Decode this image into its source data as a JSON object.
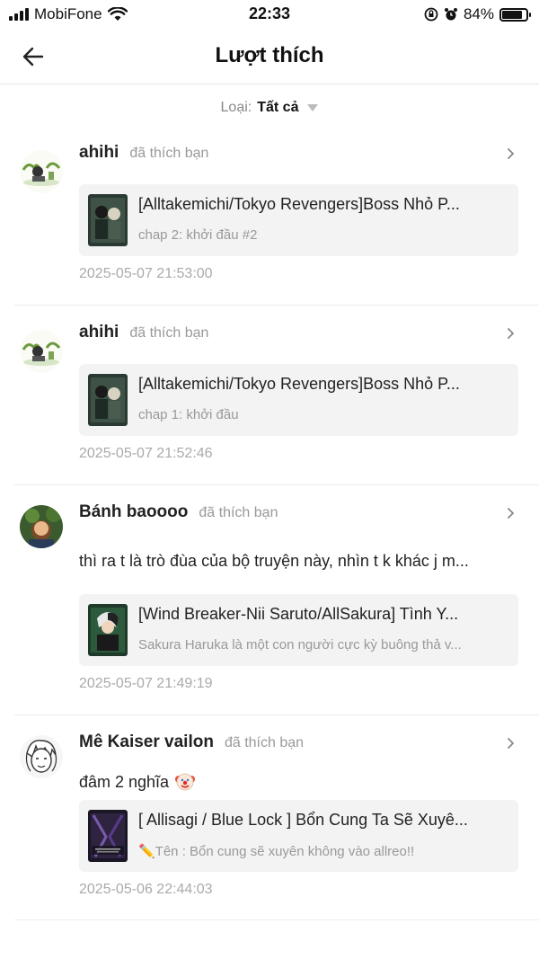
{
  "status_bar": {
    "carrier": "MobiFone",
    "time": "22:33",
    "battery_percent": "84%",
    "battery_level": 0.84,
    "icons": [
      "signal-icon",
      "wifi-icon",
      "screen-lock-icon",
      "alarm-icon",
      "battery-icon"
    ]
  },
  "header": {
    "title": "Lượt thích",
    "back_icon": "arrow-left-icon"
  },
  "filter": {
    "label": "Loại:",
    "value": "Tất cả",
    "icon": "caret-down-icon"
  },
  "notifications": [
    {
      "user": "ahihi",
      "action": "đã thích bạn",
      "comment": "",
      "card_title": "[Alltakemichi/Tokyo Revengers]Boss Nhỏ P...",
      "card_subtitle": "chap 2: khởi đầu #2",
      "timestamp": "2025-05-07 21:53:00"
    },
    {
      "user": "ahihi",
      "action": "đã thích bạn",
      "comment": "",
      "card_title": "[Alltakemichi/Tokyo Revengers]Boss Nhỏ P...",
      "card_subtitle": "chap 1: khởi đầu",
      "timestamp": "2025-05-07 21:52:46"
    },
    {
      "user": "Bánh baoooo",
      "action": "đã thích bạn",
      "comment": "thì ra t là trò đùa của bộ truyện này, nhìn t k khác j m...",
      "card_title": "[Wind Breaker-Nii Saruto/AllSakura] Tình Y...",
      "card_subtitle": "Sakura Haruka là một con người cực kỳ buông thả v...",
      "timestamp": "2025-05-07 21:49:19"
    },
    {
      "user": "Mê Kaiser vailon",
      "action": "đã thích bạn",
      "comment": "đâm 2 nghĩa",
      "comment_icon": "clown-emoji-icon",
      "card_title": "[ Allisagi / Blue Lock ] Bổn Cung Ta Sẽ Xuyê...",
      "card_subtitle": "✏️Tên : Bổn cung sẽ xuyên không vào allreo!!",
      "timestamp": "2025-05-06 22:44:03"
    }
  ],
  "colors": {
    "card_bg": "#f3f3f3",
    "muted_text": "#999999",
    "timestamp_text": "#aaaaaa",
    "divider": "#ececec"
  }
}
